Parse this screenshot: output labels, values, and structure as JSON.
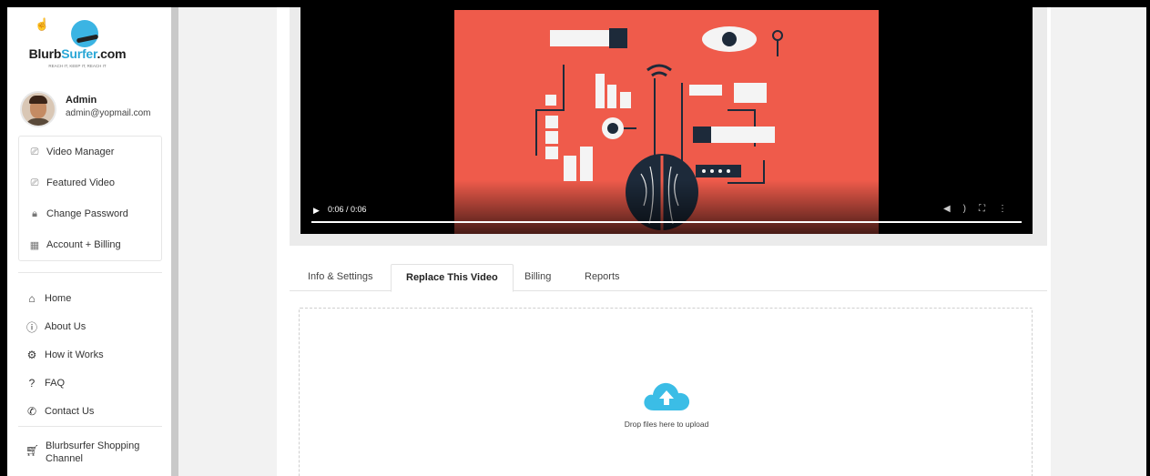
{
  "brand": {
    "prefix": "Blurb",
    "surf": "Surfer",
    "suffix": ".com",
    "tagline": "REACH IT, KEEP IT, REACH IT"
  },
  "user": {
    "name": "Admin",
    "email": "admin@yopmail.com"
  },
  "account_menu": [
    {
      "label": "Video Manager",
      "icon": "video-icon"
    },
    {
      "label": "Featured Video",
      "icon": "video-icon"
    },
    {
      "label": "Change Password",
      "icon": "lock-icon"
    },
    {
      "label": "Account + Billing",
      "icon": "billing-icon"
    }
  ],
  "nav": [
    {
      "label": "Home",
      "icon": "home-icon"
    },
    {
      "label": "About Us",
      "icon": "info-icon"
    },
    {
      "label": "How it Works",
      "icon": "gears-icon"
    },
    {
      "label": "FAQ",
      "icon": "question-icon"
    },
    {
      "label": "Contact Us",
      "icon": "phone-icon"
    }
  ],
  "shop": {
    "label": "Blurbsurfer Shopping Channel",
    "icon": "cart-icon"
  },
  "player": {
    "time": "0:06 / 0:06",
    "progress": 1.0
  },
  "tabs": [
    {
      "label": "Info & Settings",
      "active": false
    },
    {
      "label": "Replace This Video",
      "active": true
    },
    {
      "label": "Billing",
      "active": false
    },
    {
      "label": "Reports",
      "active": false
    }
  ],
  "dropzone": {
    "text": "Drop files here to upload",
    "icon": "cloud-upload-icon"
  },
  "colors": {
    "accent": "#2aa7d6",
    "video_bg": "#ef5b4b",
    "cloud": "#3bbde6"
  }
}
